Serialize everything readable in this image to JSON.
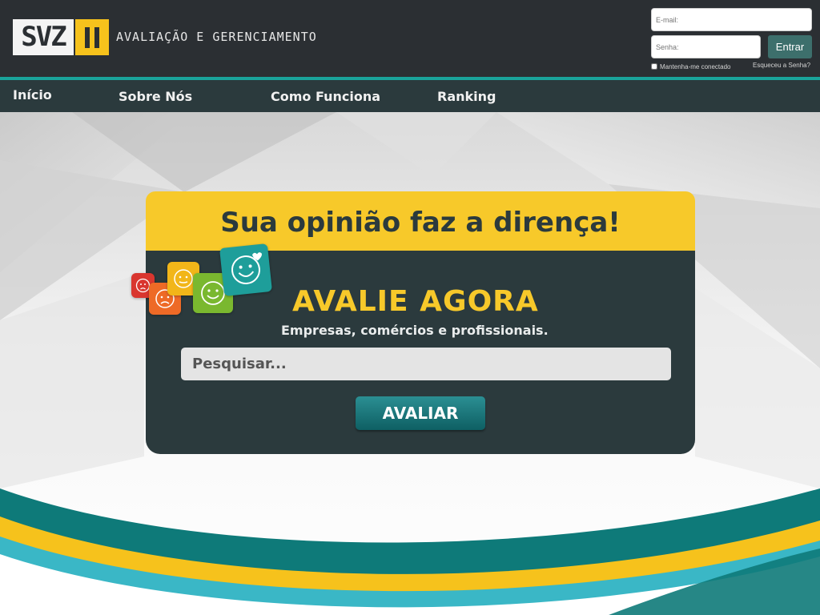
{
  "header": {
    "logo_text": "SVZ",
    "tagline": "AVALIAÇÃO E GERENCIAMENTO",
    "login": {
      "email_placeholder": "E-mail:",
      "password_placeholder": "Senha:",
      "submit_label": "Entrar",
      "remember_label": "Mantenha-me conectado",
      "forgot_label": "Esqueceu a Senha?"
    }
  },
  "nav": {
    "items": [
      {
        "label": "Início"
      },
      {
        "label": "Sobre Nós"
      },
      {
        "label": "Como Funciona"
      },
      {
        "label": "Ranking"
      }
    ]
  },
  "hero": {
    "headline": "Sua opinião faz a dirença!",
    "title": "AVALIE AGORA",
    "subtitle": "Empresas, comércios e profissionais.",
    "search_placeholder": "Pesquisar...",
    "button_label": "AVALIAR"
  },
  "colors": {
    "header_bg": "#2b2f33",
    "nav_bg": "#2b3a3d",
    "accent_yellow": "#f7c92a",
    "accent_teal": "#0e7c7b"
  },
  "icons": [
    "sad-face-icon",
    "unhappy-face-icon",
    "neutral-face-icon",
    "happy-face-icon",
    "very-happy-face-icon"
  ]
}
